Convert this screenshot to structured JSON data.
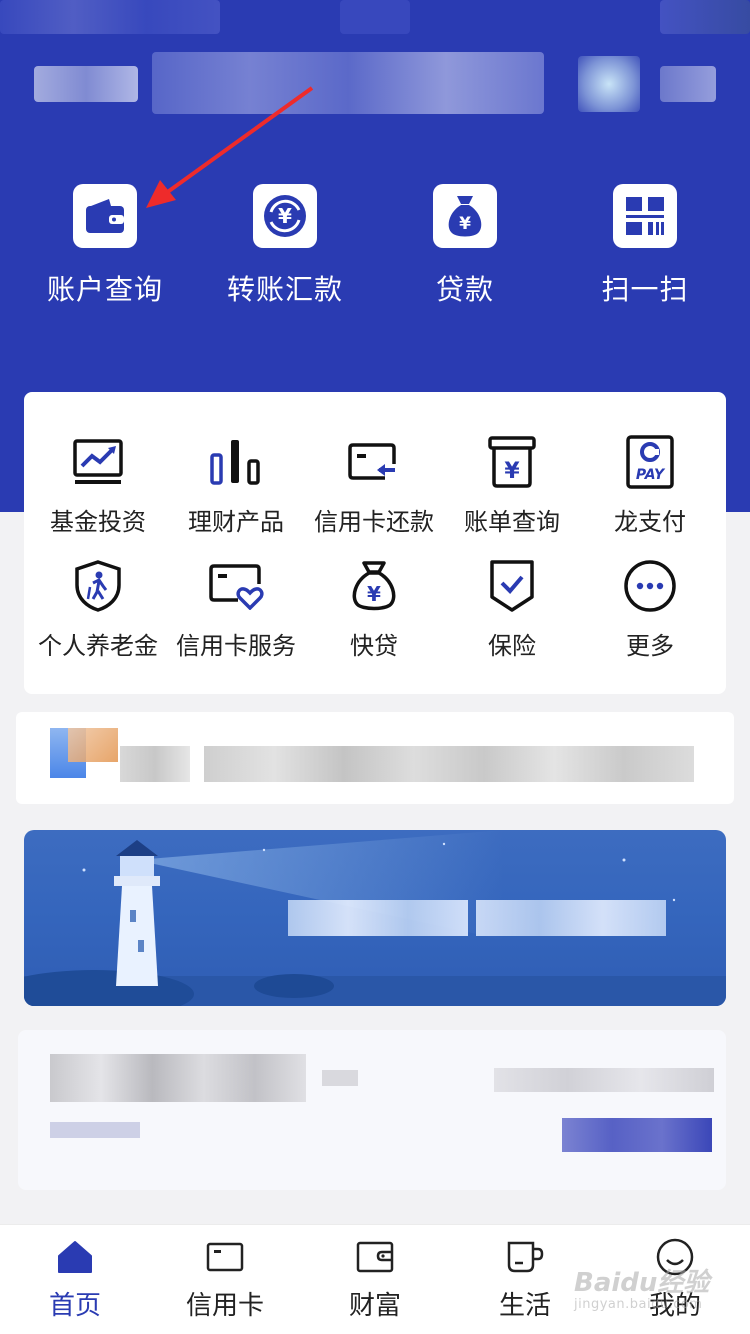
{
  "colors": {
    "brand_blue": "#2a3bb2",
    "tab_active": "#2a3bb2",
    "text_dark": "#222222",
    "arrow_red": "#ee2b2b"
  },
  "quick_actions": [
    {
      "label": "账户查询",
      "icon": "wallet-icon"
    },
    {
      "label": "转账汇款",
      "icon": "yuan-transfer-icon"
    },
    {
      "label": "贷款",
      "icon": "money-bag-icon"
    },
    {
      "label": "扫一扫",
      "icon": "scan-icon"
    }
  ],
  "services": [
    {
      "label": "基金投资",
      "icon": "chart-monitor-icon"
    },
    {
      "label": "理财产品",
      "icon": "bar-chart-icon"
    },
    {
      "label": "信用卡还款",
      "icon": "card-repay-icon"
    },
    {
      "label": "账单查询",
      "icon": "bill-box-icon"
    },
    {
      "label": "龙支付",
      "icon": "pay-icon"
    },
    {
      "label": "个人养老金",
      "icon": "pension-shield-icon"
    },
    {
      "label": "信用卡服务",
      "icon": "card-heart-icon"
    },
    {
      "label": "快贷",
      "icon": "money-bag-icon"
    },
    {
      "label": "保险",
      "icon": "insurance-check-icon"
    },
    {
      "label": "更多",
      "icon": "more-dots-icon"
    }
  ],
  "pay_icon_text": "PAY",
  "tabs": [
    {
      "label": "首页",
      "icon": "home-icon",
      "active": true
    },
    {
      "label": "信用卡",
      "icon": "credit-card-icon",
      "active": false
    },
    {
      "label": "财富",
      "icon": "wealth-wallet-icon",
      "active": false
    },
    {
      "label": "生活",
      "icon": "life-cup-icon",
      "active": false
    },
    {
      "label": "我的",
      "icon": "profile-smile-icon",
      "active": false
    }
  ],
  "watermark": {
    "main": "Baidu经验",
    "sub": "jingyan.baidu.com"
  }
}
